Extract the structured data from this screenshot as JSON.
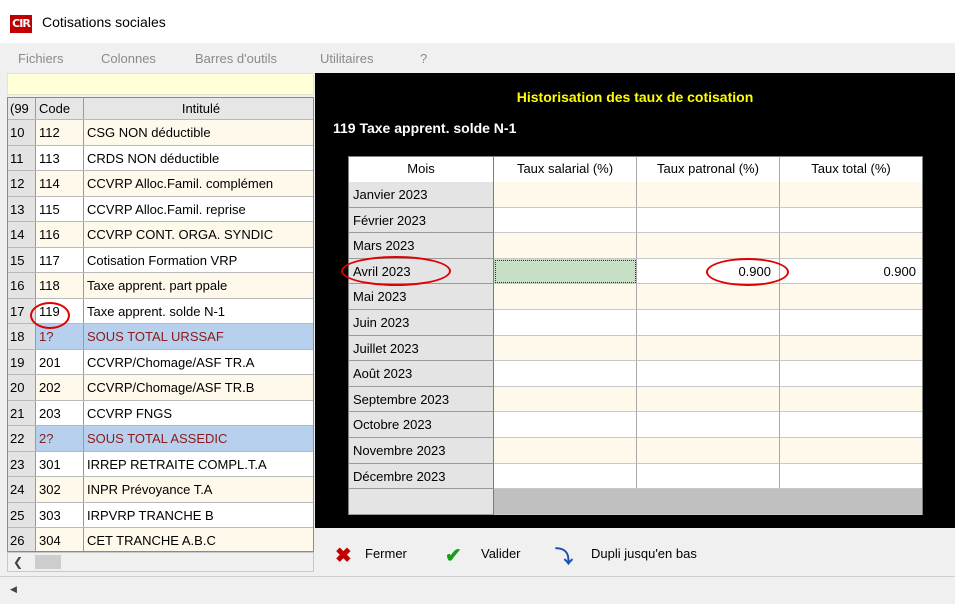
{
  "window": {
    "title": "Cotisations sociales",
    "logo_text": "CIR"
  },
  "menu": [
    "Fichiers",
    "Colonnes",
    "Barres d'outils",
    "Utilitaires",
    "?"
  ],
  "left_grid": {
    "headers": {
      "num": "(99",
      "code": "Code",
      "intitule": "Intitulé"
    },
    "rows": [
      {
        "num": "10",
        "code": "112",
        "label": "CSG NON déductible",
        "highlight": false
      },
      {
        "num": "11",
        "code": "113",
        "label": "CRDS NON déductible",
        "highlight": false
      },
      {
        "num": "12",
        "code": "114",
        "label": "CCVRP Alloc.Famil. complémen",
        "highlight": false
      },
      {
        "num": "13",
        "code": "115",
        "label": "CCVRP Alloc.Famil. reprise",
        "highlight": false
      },
      {
        "num": "14",
        "code": "116",
        "label": "CCVRP CONT. ORGA. SYNDIC",
        "highlight": false
      },
      {
        "num": "15",
        "code": "117",
        "label": "Cotisation Formation VRP",
        "highlight": false
      },
      {
        "num": "16",
        "code": "118",
        "label": "Taxe apprent. part ppale",
        "highlight": false
      },
      {
        "num": "17",
        "code": "119",
        "label": "Taxe apprent. solde N-1",
        "highlight": false
      },
      {
        "num": "18",
        "code": "1?",
        "label": "SOUS TOTAL URSSAF",
        "highlight": true
      },
      {
        "num": "19",
        "code": "201",
        "label": "CCVRP/Chomage/ASF TR.A",
        "highlight": false
      },
      {
        "num": "20",
        "code": "202",
        "label": "CCVRP/Chomage/ASF TR.B",
        "highlight": false
      },
      {
        "num": "21",
        "code": "203",
        "label": "CCVRP FNGS",
        "highlight": false
      },
      {
        "num": "22",
        "code": "2?",
        "label": "SOUS TOTAL ASSEDIC",
        "highlight": true
      },
      {
        "num": "23",
        "code": "301",
        "label": "IRREP RETRAITE COMPL.T.A",
        "highlight": false
      },
      {
        "num": "24",
        "code": "302",
        "label": "INPR Prévoyance T.A",
        "highlight": false
      },
      {
        "num": "25",
        "code": "303",
        "label": "IRPVRP TRANCHE B",
        "highlight": false
      },
      {
        "num": "26",
        "code": "304",
        "label": "CET TRANCHE A.B.C",
        "highlight": false
      }
    ]
  },
  "panel": {
    "title": "Historisation des taux de cotisation",
    "subtitle": "119 Taxe apprent. solde N-1",
    "headers": [
      "Mois",
      "Taux salarial (%)",
      "Taux patronal (%)",
      "Taux total (%)"
    ],
    "rows": [
      {
        "mois": "Janvier 2023",
        "salarial": "",
        "patronal": "",
        "total": ""
      },
      {
        "mois": "Février 2023",
        "salarial": "",
        "patronal": "",
        "total": ""
      },
      {
        "mois": "Mars 2023",
        "salarial": "",
        "patronal": "",
        "total": ""
      },
      {
        "mois": "Avril 2023",
        "salarial": "",
        "patronal": "0.900",
        "total": "0.900"
      },
      {
        "mois": "Mai 2023",
        "salarial": "",
        "patronal": "",
        "total": ""
      },
      {
        "mois": "Juin 2023",
        "salarial": "",
        "patronal": "",
        "total": ""
      },
      {
        "mois": "Juillet 2023",
        "salarial": "",
        "patronal": "",
        "total": ""
      },
      {
        "mois": "Août 2023",
        "salarial": "",
        "patronal": "",
        "total": ""
      },
      {
        "mois": "Septembre 2023",
        "salarial": "",
        "patronal": "",
        "total": ""
      },
      {
        "mois": "Octobre 2023",
        "salarial": "",
        "patronal": "",
        "total": ""
      },
      {
        "mois": "Novembre 2023",
        "salarial": "",
        "patronal": "",
        "total": ""
      },
      {
        "mois": "Décembre 2023",
        "salarial": "",
        "patronal": "",
        "total": ""
      },
      {
        "mois": "",
        "salarial": "",
        "patronal": "",
        "total": ""
      }
    ]
  },
  "actions": {
    "close": "Fermer",
    "validate": "Valider",
    "duplicate": "Dupli jusqu'en bas"
  },
  "colors": {
    "highlight_row": "#b7d0ee",
    "highlight_text": "#8b1a1a",
    "panel_title": "#ffff00",
    "annotation": "#e00000",
    "selected_cell": "#c7dfc4"
  }
}
